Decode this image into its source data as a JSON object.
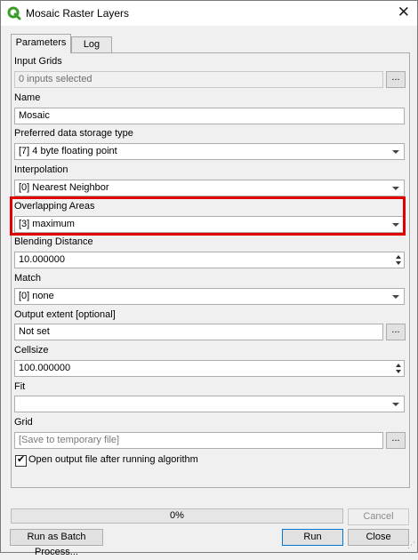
{
  "window": {
    "title": "Mosaic Raster Layers",
    "close_glyph": "✕",
    "accent": "#e00000",
    "icon_color": "#3c9c28"
  },
  "tabs": [
    "Parameters",
    "Log"
  ],
  "params": {
    "input_grids": {
      "label": "Input Grids",
      "value": "0 inputs selected",
      "button": "..."
    },
    "name": {
      "label": "Name",
      "value": "Mosaic"
    },
    "storage": {
      "label": "Preferred data storage type",
      "value": "[7] 4 byte floating point"
    },
    "interpolation": {
      "label": "Interpolation",
      "value": "[0] Nearest Neighbor"
    },
    "overlapping": {
      "label": "Overlapping Areas",
      "value": "[3] maximum"
    },
    "blending": {
      "label": "Blending Distance",
      "value": "10.000000"
    },
    "match": {
      "label": "Match",
      "value": "[0] none"
    },
    "extent": {
      "label": "Output extent [optional]",
      "value": "Not set",
      "button": "..."
    },
    "cellsize": {
      "label": "Cellsize",
      "value": "100.000000"
    },
    "fit": {
      "label": "Fit",
      "value": ""
    },
    "grid": {
      "label": "Grid",
      "placeholder": "[Save to temporary file]",
      "button": "..."
    },
    "open_output": {
      "label": "Open output file after running algorithm",
      "checked": true
    }
  },
  "footer": {
    "progress_text": "0%",
    "progress": 0,
    "cancel": "Cancel",
    "batch": "Run as Batch Process...",
    "run": "Run",
    "close": "Close"
  }
}
